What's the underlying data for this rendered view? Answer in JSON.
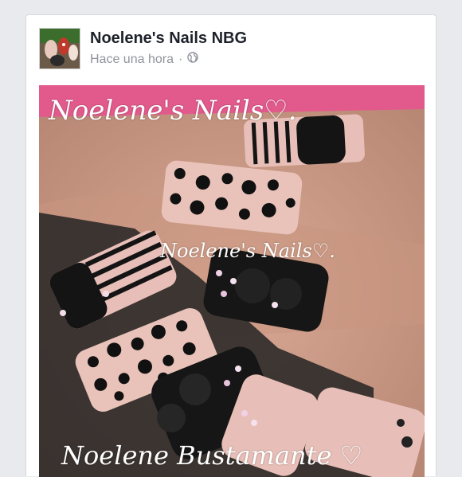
{
  "post": {
    "page_name": "Noelene's Nails NBG",
    "timestamp": "Hace una hora",
    "privacy_icon": "globe-icon"
  },
  "photo": {
    "watermark_top": "Noelene's Nails♡.",
    "watermark_middle": "Noelene's Nails♡.",
    "watermark_bottom": "Noelene Bustamante ♡"
  },
  "colors": {
    "background": "#e9eaee",
    "card": "#ffffff",
    "name_text": "#1d2129",
    "meta_text": "#90949c",
    "nail_pink": "#e8bfb8",
    "nail_black": "#141414",
    "backdrop_pink": "#e0467e"
  }
}
